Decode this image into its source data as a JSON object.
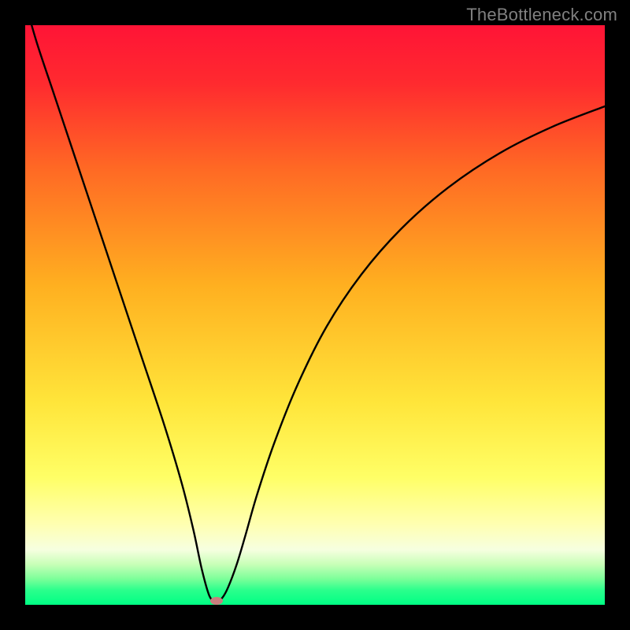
{
  "watermark": "TheBottleneck.com",
  "colors": {
    "frame": "#000000",
    "marker": "#c97e7e",
    "curve": "#000000",
    "gradient_stops": [
      {
        "offset": 0.0,
        "color": "#ff1436"
      },
      {
        "offset": 0.1,
        "color": "#ff2a2f"
      },
      {
        "offset": 0.25,
        "color": "#ff6a24"
      },
      {
        "offset": 0.45,
        "color": "#ffb020"
      },
      {
        "offset": 0.65,
        "color": "#ffe53a"
      },
      {
        "offset": 0.78,
        "color": "#ffff66"
      },
      {
        "offset": 0.86,
        "color": "#ffffb0"
      },
      {
        "offset": 0.905,
        "color": "#f6ffe0"
      },
      {
        "offset": 0.93,
        "color": "#c8ffb8"
      },
      {
        "offset": 0.955,
        "color": "#7dff9a"
      },
      {
        "offset": 0.975,
        "color": "#2aff8c"
      },
      {
        "offset": 1.0,
        "color": "#00ff84"
      }
    ]
  },
  "chart_data": {
    "type": "line",
    "title": "",
    "xlabel": "",
    "ylabel": "",
    "xlim": [
      0,
      100
    ],
    "ylim": [
      0,
      100
    ],
    "grid": false,
    "legend": false,
    "series": [
      {
        "name": "bottleneck-curve",
        "x": [
          0,
          2,
          5,
          8,
          12,
          16,
          20,
          24,
          27,
          29,
          30.5,
          31.8,
          33,
          34,
          35,
          36.5,
          38,
          40,
          43,
          47,
          52,
          58,
          65,
          73,
          82,
          91,
          100
        ],
        "y": [
          104,
          97,
          88,
          79,
          67,
          55,
          43,
          31,
          21,
          13,
          6,
          1.5,
          0.5,
          1.2,
          3,
          7,
          12,
          19,
          28,
          38,
          48,
          57,
          65,
          72,
          78,
          82.5,
          86
        ]
      }
    ],
    "annotations": [
      {
        "name": "optimal-point",
        "x": 33,
        "y": 0.7,
        "shape": "ellipse"
      }
    ],
    "note": "x and y are in percent of the plot area; y=0 at bottom, y=100 at top."
  }
}
